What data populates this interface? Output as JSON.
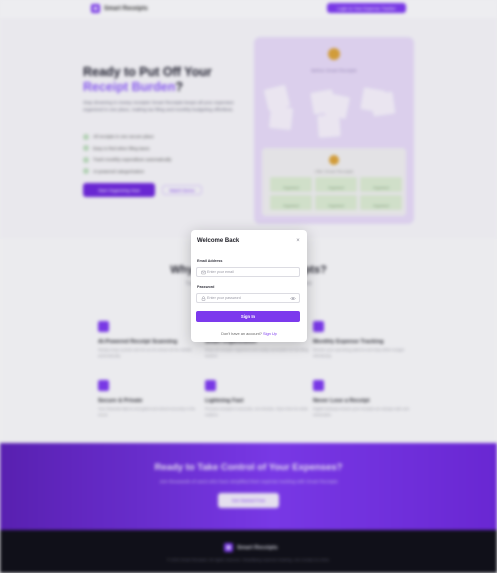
{
  "brand": {
    "name": "Smart Receipts",
    "logo_glyph": "◆"
  },
  "header": {
    "login_button": "Login to Your Expense Tracker"
  },
  "hero": {
    "title_line1": "Ready to Put Off Your",
    "title_highlight": "Receipt Burden",
    "title_punct": "?",
    "description": "Stop drowning in messy receipts! Smart Receipts keeps all your expenses organized in one place, making tax filing and monthly budgeting effortless.",
    "checklist": [
      "All receipts in one secure place",
      "Easy to find when filing taxes",
      "Track monthly expenditure automatically",
      "AI-powered categorization"
    ],
    "cta_primary": "Start Organizing Now",
    "cta_secondary": "Watch Demo"
  },
  "preview_card": {
    "before_title": "Before Smart Receipts",
    "after_title": "After Smart Receipts",
    "grid_label": "Organized"
  },
  "features_section": {
    "title": "Why Choose Smart Receipts?",
    "subtitle": "Transform your expense management with our intelligent",
    "items": [
      {
        "title": "AI-Powered Receipt Scanning",
        "desc": "Simply snap a photo and let our AI extract all the details automatically."
      },
      {
        "title": "Smart Organization",
        "desc": "Keep all receipts organized and easily accessible for tax filing season."
      },
      {
        "title": "Monthly Expense Tracking",
        "desc": "Monitor your spending patterns and stay within budget effortlessly."
      },
      {
        "title": "Secure & Private",
        "desc": "Your financial data is encrypted and stored securely in the cloud."
      },
      {
        "title": "Lightning Fast",
        "desc": "Process receipts in seconds, not minutes. Save time for what matters."
      },
      {
        "title": "Never Lose a Receipt",
        "desc": "Digital backups ensure your receipts are always safe and retrievable."
      }
    ]
  },
  "cta_band": {
    "title": "Ready to Take Control of Your Expenses?",
    "subtitle": "Join thousands of users who have simplified their expense tracking with Smart Receipts",
    "button": "Get Started Free"
  },
  "footer": {
    "copyright": "© 2024 Smart Receipts. All rights reserved. Simplifying expense tracking, one receipt at a time."
  },
  "modal": {
    "title": "Welcome Back",
    "close_glyph": "×",
    "email_label": "Email Address",
    "email_placeholder": "Enter your email",
    "email_value": "",
    "password_label": "Password",
    "password_placeholder": "Enter your password",
    "password_value": "",
    "submit": "Sign In",
    "footer_text": "Don't have an account?",
    "footer_link": "Sign Up"
  },
  "colors": {
    "accent": "#7c3aed",
    "modal_bg": "#ffffff",
    "footer_bg": "#101018"
  }
}
